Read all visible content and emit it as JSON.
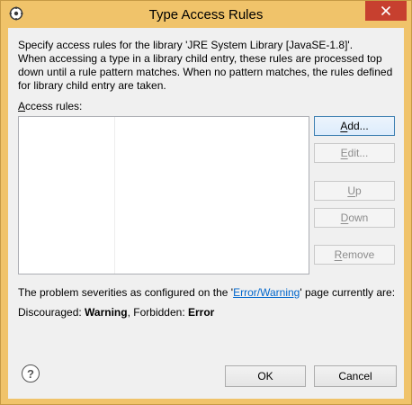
{
  "window": {
    "title": "Type Access Rules",
    "close_icon": "close-icon"
  },
  "description": {
    "line1": "Specify access rules for the library 'JRE System Library [JavaSE-1.8]'.",
    "line2": "When accessing a type in a library child entry, these rules are processed top",
    "line3": "down until a rule pattern matches. When no pattern matches, the rules defined",
    "line4": "for library child entry are taken."
  },
  "rules": {
    "label_prefix": "A",
    "label_rest": "ccess rules:",
    "items": []
  },
  "buttons": {
    "add": {
      "mnemonic": "A",
      "rest": "dd..."
    },
    "edit": {
      "mnemonic": "E",
      "rest": "dit..."
    },
    "up": {
      "mnemonic": "U",
      "rest": "p"
    },
    "down": {
      "mnemonic": "D",
      "rest": "own"
    },
    "remove": {
      "mnemonic": "R",
      "rest": "emove"
    },
    "ok": "OK",
    "cancel": "Cancel"
  },
  "severity": {
    "prefix": "The problem severities as configured on the '",
    "link": "Error/Warning",
    "suffix": "' page currently are:",
    "discouraged_label": "Discouraged: ",
    "discouraged_value": "Warning",
    "sep": ", Forbidden: ",
    "forbidden_value": "Error"
  },
  "colors": {
    "titlebar": "#f0c36a",
    "close_button": "#c7402f",
    "link": "#0066cc"
  }
}
